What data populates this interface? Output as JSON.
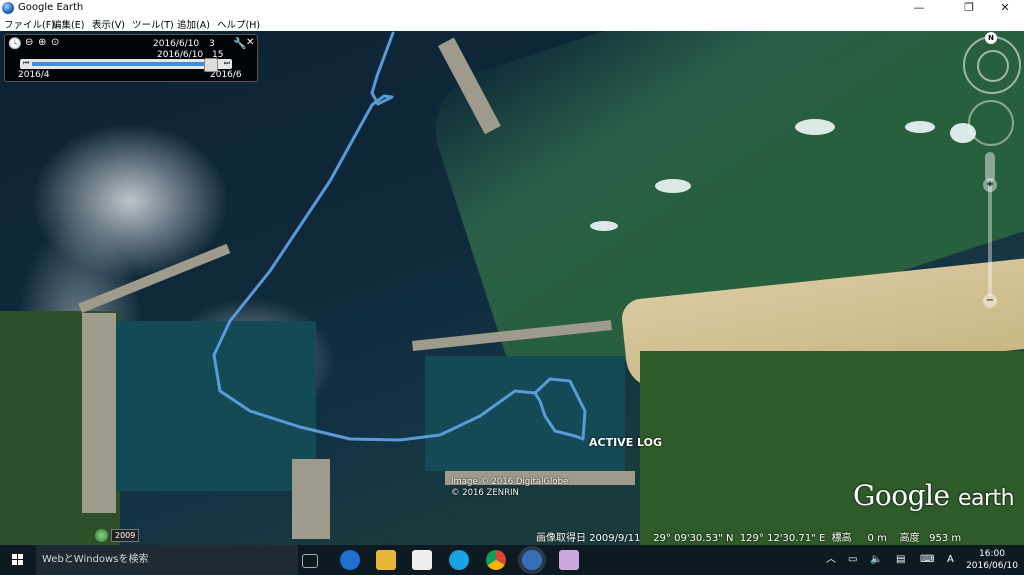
{
  "window": {
    "title": "Google Earth",
    "controls": {
      "minimize": "—",
      "maximize": "❐",
      "close": "✕"
    }
  },
  "menu": {
    "items": [
      "ファイル(F)",
      "編集(E)",
      "表示(V)",
      "ツール(T)",
      "追加(A)",
      "ヘルプ(H)"
    ]
  },
  "time_slider": {
    "current_date": "2016/6/10",
    "count": "3",
    "secondary_date": "2016/6/10",
    "secondary_value": "15",
    "range_start": "2016/4",
    "range_end": "2016/6",
    "position_fraction": 0.97
  },
  "map": {
    "track_color": "#5a9ad8",
    "track_label": "ACTIVE LOG",
    "copyright_line1": "Image © 2016 DigitalGlobe",
    "copyright_line2": "© 2016 ZENRIN",
    "logo_google": "Google",
    "logo_earth": "earth",
    "historical_year": "2009"
  },
  "status": {
    "image_date_label": "画像取得日",
    "image_date": "2009/9/11",
    "lat": "29° 09'30.53\" N",
    "lon": "129° 12'30.71\" E",
    "elev_label": "標高",
    "elev_value": "0 m",
    "alt_label": "高度",
    "alt_value": "953 m"
  },
  "navigation": {
    "north_label": "N",
    "zoom_in": "+",
    "zoom_out": "−"
  },
  "taskbar": {
    "search_placeholder": "WebとWindowsを検索",
    "tray_ime": "A",
    "time": "16:00",
    "date": "2016/06/10"
  }
}
